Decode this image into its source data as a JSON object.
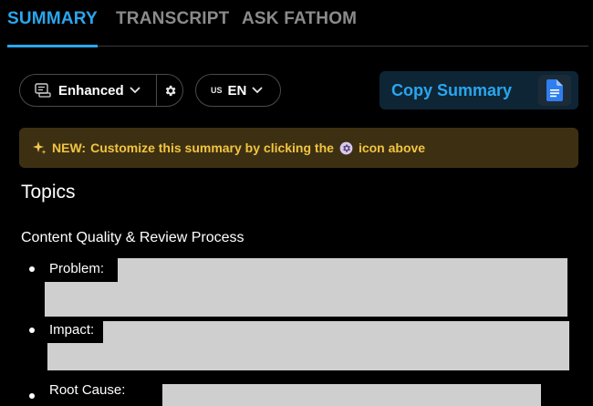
{
  "tabs": [
    {
      "label": "SUMMARY",
      "active": true
    },
    {
      "label": "TRANSCRIPT",
      "active": false
    },
    {
      "label": "ASK FATHOM",
      "active": false
    }
  ],
  "toolbar": {
    "mode_label": "Enhanced",
    "language_flag": "US",
    "language_label": "EN",
    "copy_label": "Copy Summary"
  },
  "banner": {
    "prefix": "NEW:",
    "text_before": "Customize this summary by clicking the",
    "text_after": "icon above"
  },
  "content": {
    "heading": "Topics",
    "section_title": "Content Quality & Review Process",
    "bullets": [
      "Problem:",
      "Impact:",
      "Root Cause:"
    ]
  },
  "colors": {
    "accent": "#2aa6ee",
    "banner_bg": "#3d3012",
    "banner_text": "#f2c441",
    "redaction": "#cfcfcf"
  }
}
